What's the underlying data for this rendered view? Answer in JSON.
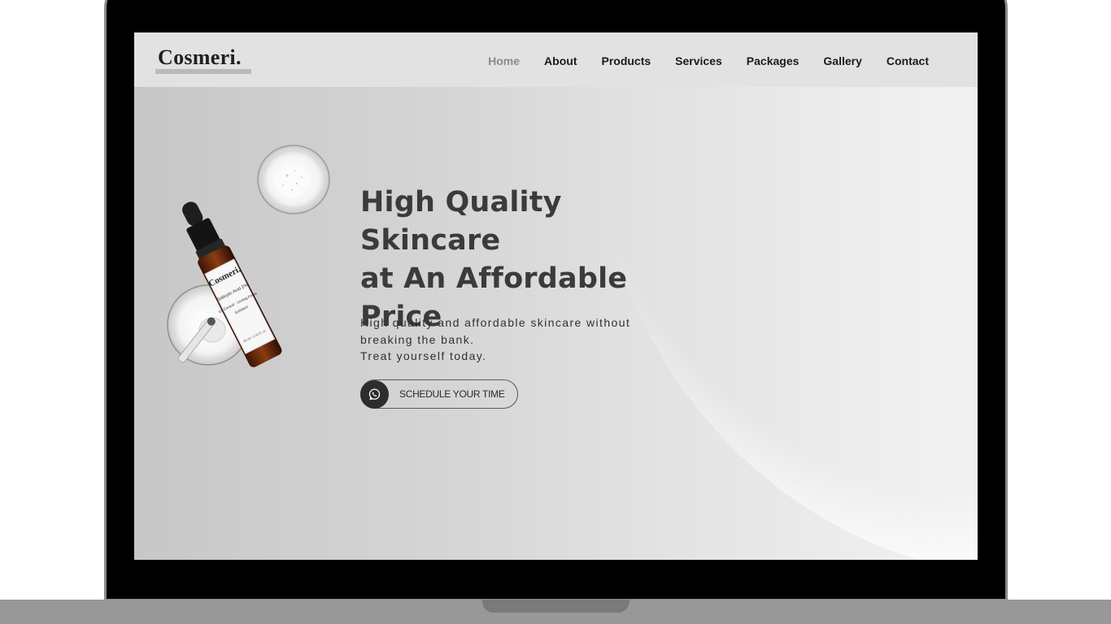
{
  "site": {
    "logo": "Cosmeri."
  },
  "nav": {
    "items": [
      {
        "label": "Home",
        "active": true
      },
      {
        "label": "About",
        "active": false
      },
      {
        "label": "Products",
        "active": false
      },
      {
        "label": "Services",
        "active": false
      },
      {
        "label": "Packages",
        "active": false
      },
      {
        "label": "Gallery",
        "active": false
      },
      {
        "label": "Contact",
        "active": false
      }
    ]
  },
  "hero": {
    "title_lines": [
      "High Quality Skincare",
      "at An Affordable",
      "Price"
    ],
    "subtitle_lines": [
      "High quality and affordable skincare without",
      "breaking the bank.",
      "Treat yourself today."
    ],
    "cta_label": "SCHEDULE YOUR TIME",
    "cta_icon": "whatsapp-icon"
  },
  "product_bottle": {
    "brand": "Cosmeri.",
    "label_lines": [
      "Salicylic Acid 2%",
      "Oil Control · Unclog Pores",
      "Exfoliant",
      "30 ml / 1.01 fl. oz."
    ]
  },
  "colors": {
    "title": "#393b3d",
    "nav_active": "#8b8b8b",
    "cta_icon_bg": "#2b2d2f"
  }
}
